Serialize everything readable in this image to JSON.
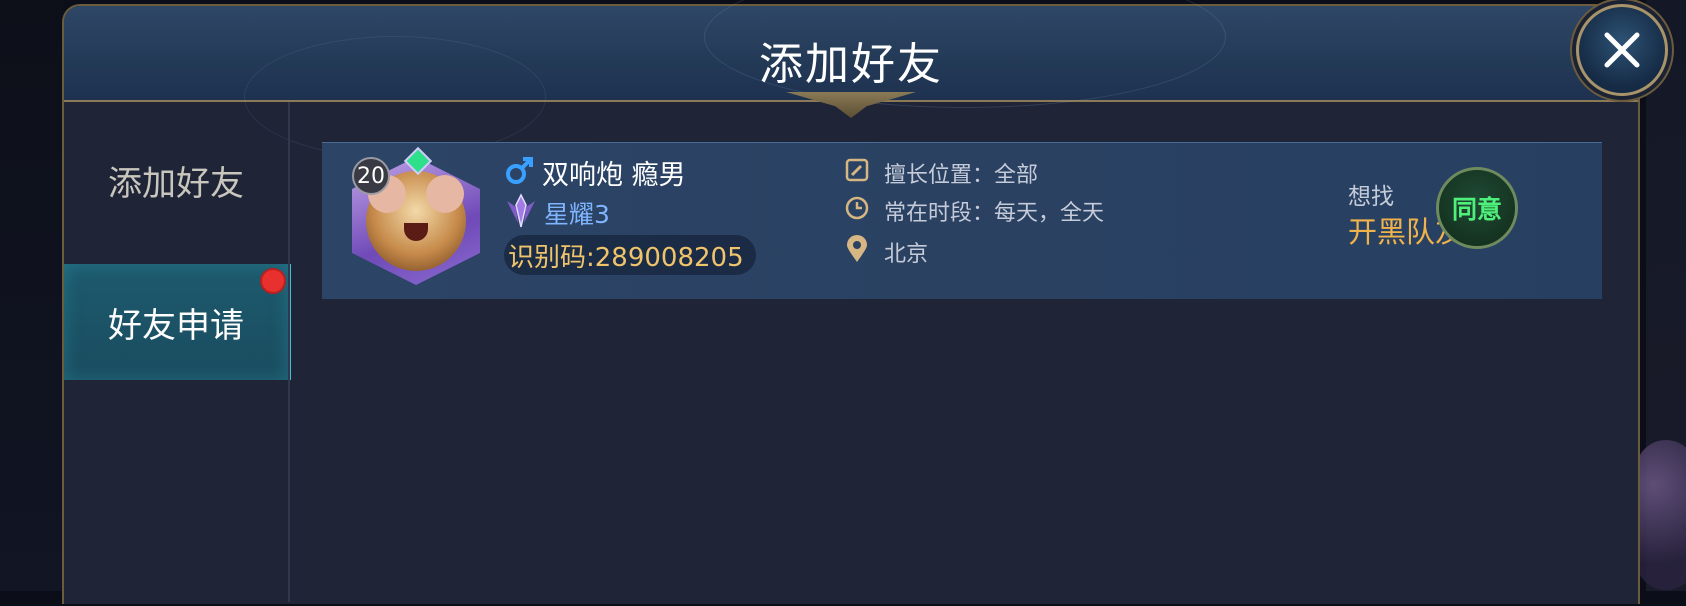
{
  "dialog": {
    "title": "添加好友",
    "close_icon": "close-icon"
  },
  "sidebar": {
    "items": [
      {
        "label": "添加好友",
        "selected": false
      },
      {
        "label": "好友申请",
        "selected": true,
        "has_notification": true
      }
    ]
  },
  "request": {
    "level": "20",
    "gender_icon": "male-icon",
    "name": "双响炮 瘾男",
    "rank_icon": "star-glory-rank-icon",
    "rank": "星耀3",
    "id_code": "识别码:289008205",
    "position_label": "擅长位置：全部",
    "time_label": "常在时段：每天，全天",
    "location": "北京",
    "seek_label": "想找",
    "seek_value": "开黑队友",
    "agree_label": "同意"
  },
  "colors": {
    "accent_gold": "#f0b24a",
    "agree_green": "#4ef07a",
    "selected_tab": "#1d5a6e",
    "notification_red": "#e8312f",
    "rank_blue": "#7fb4ff"
  }
}
